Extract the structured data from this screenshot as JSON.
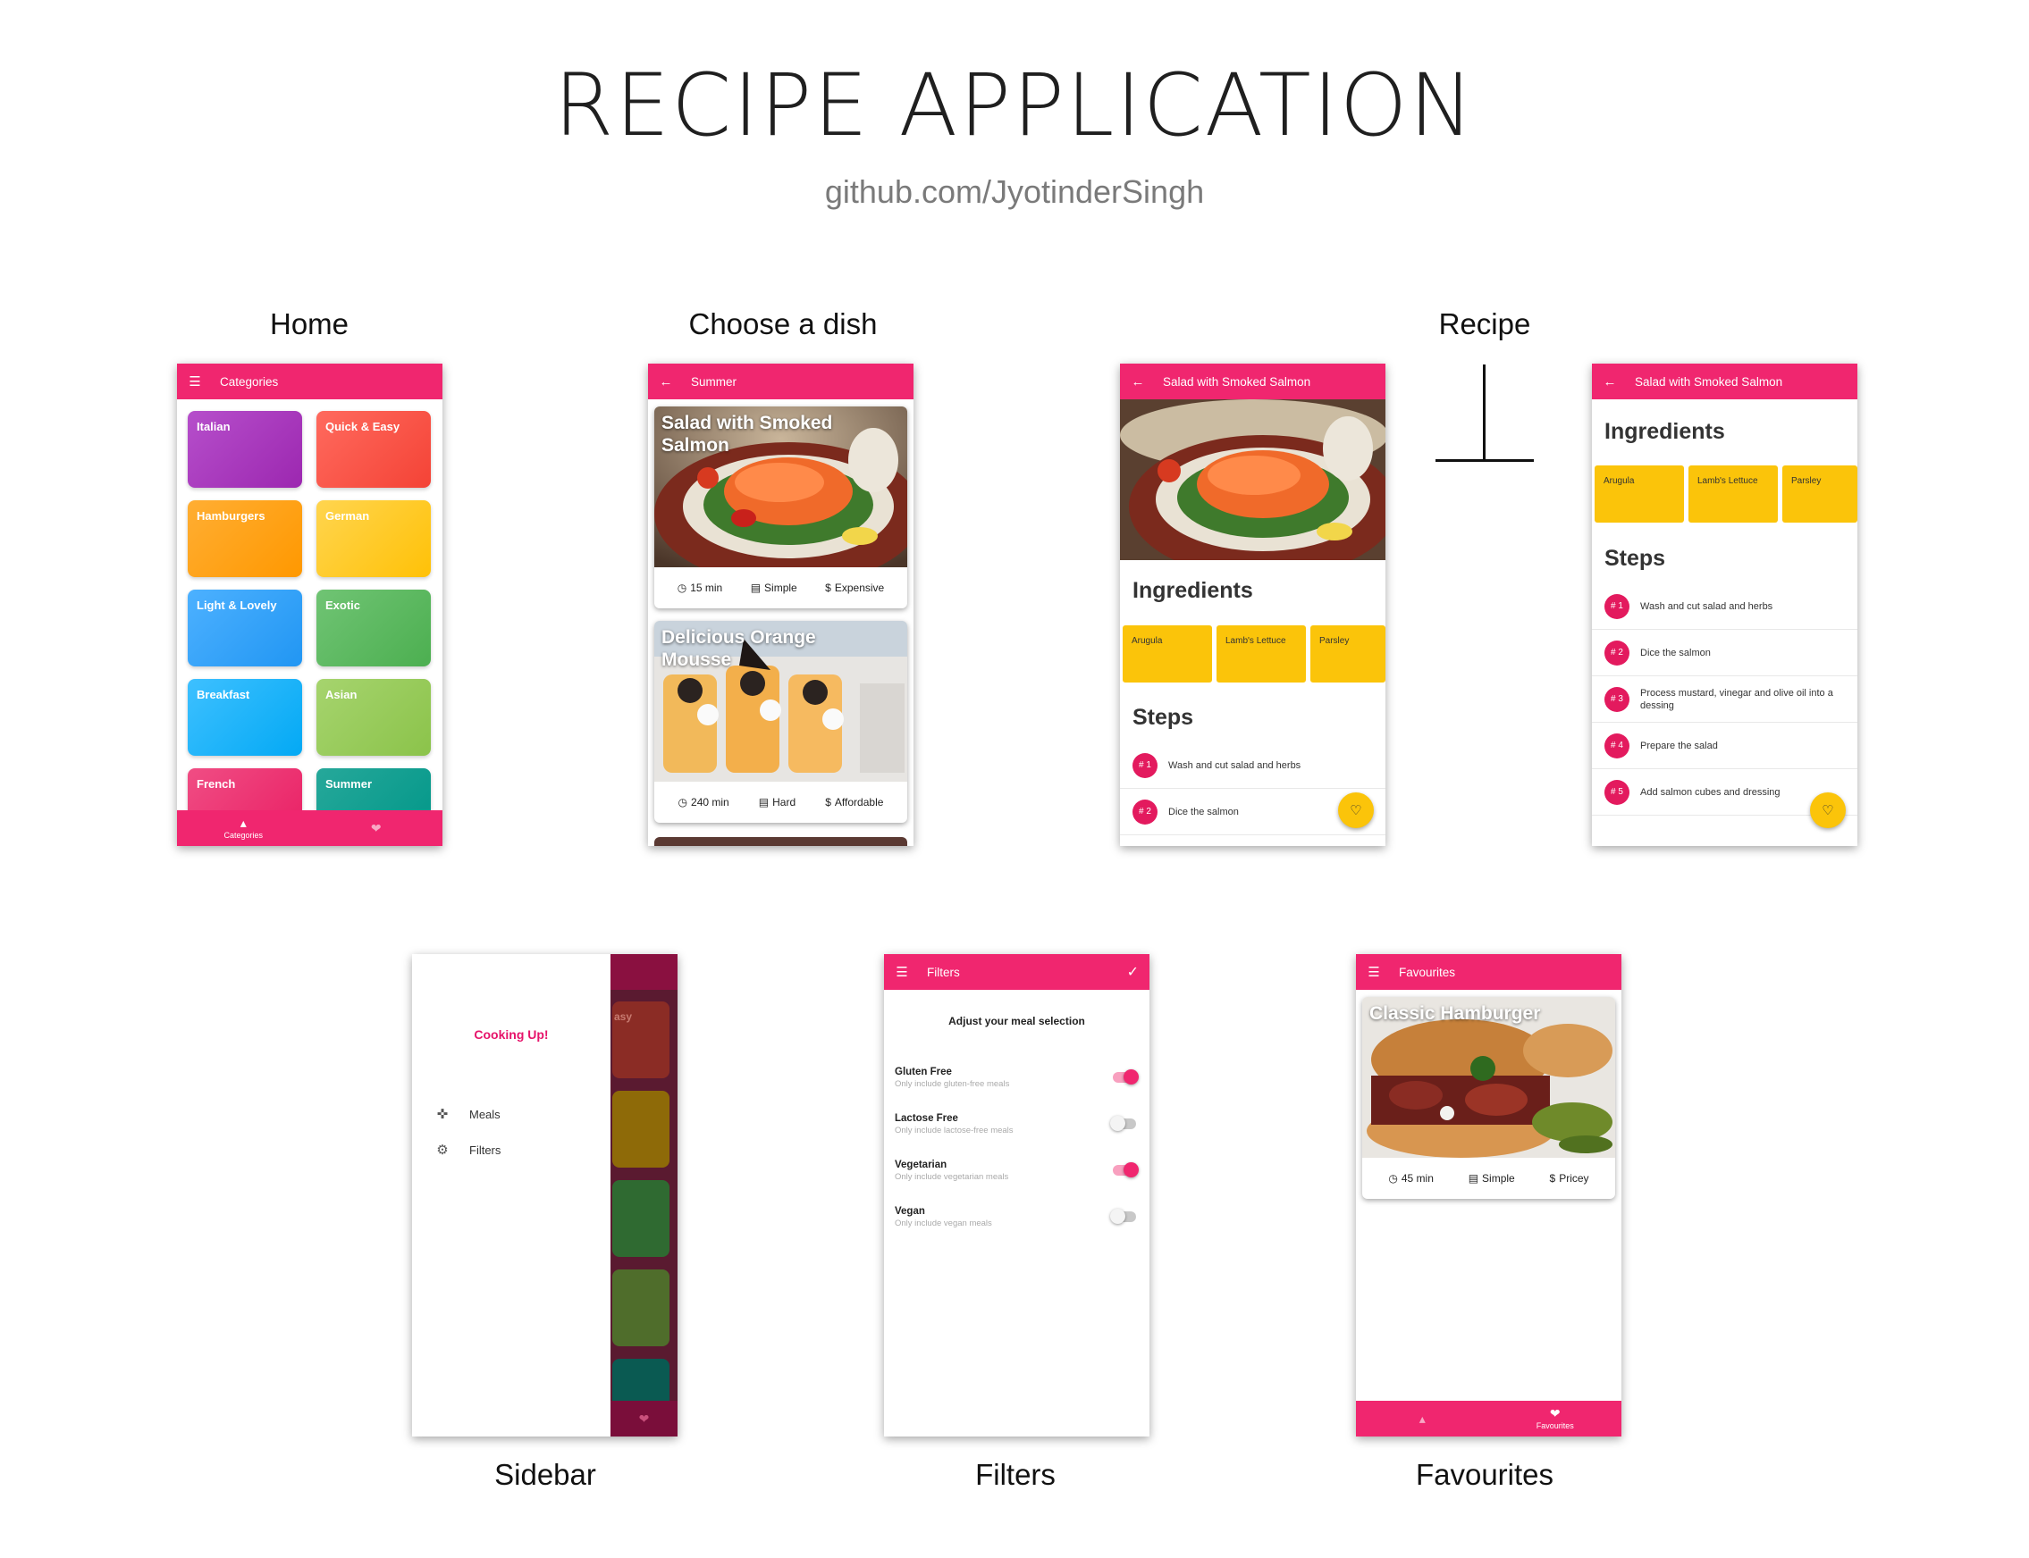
{
  "header": {
    "title": "RECIPE APPLICATION",
    "subtitle": "github.com/JyotinderSingh"
  },
  "labels": {
    "home": "Home",
    "choose": "Choose a dish",
    "recipe": "Recipe",
    "sidebar": "Sidebar",
    "filters": "Filters",
    "favourites": "Favourites"
  },
  "home": {
    "appbar_title": "Categories",
    "categories": [
      {
        "label": "Italian",
        "color": "#9c27b0"
      },
      {
        "label": "Quick & Easy",
        "color": "#f44336"
      },
      {
        "label": "Hamburgers",
        "color": "#ff9800"
      },
      {
        "label": "German",
        "color": "#ffc107"
      },
      {
        "label": "Light & Lovely",
        "color": "#2196f3"
      },
      {
        "label": "Exotic",
        "color": "#4caf50"
      },
      {
        "label": "Breakfast",
        "color": "#03a9f4"
      },
      {
        "label": "Asian",
        "color": "#8bc34a"
      },
      {
        "label": "French",
        "color": "#e91e63"
      },
      {
        "label": "Summer",
        "color": "#009688"
      }
    ],
    "nav": {
      "categories_label": "Categories"
    }
  },
  "choose": {
    "appbar_title": "Summer",
    "dishes": [
      {
        "title": "Salad with Smoked Salmon",
        "duration": "15 min",
        "complexity": "Simple",
        "affordability": "Expensive"
      },
      {
        "title": "Delicious Orange Mousse",
        "duration": "240 min",
        "complexity": "Hard",
        "affordability": "Affordable"
      }
    ]
  },
  "recipe": {
    "appbar_title": "Salad with Smoked Salmon",
    "ingredients_title": "Ingredients",
    "ingredients": [
      "Arugula",
      "Lamb's Lettuce",
      "Parsley"
    ],
    "steps_title": "Steps",
    "steps": [
      {
        "num": "# 1",
        "text": "Wash and cut salad and herbs"
      },
      {
        "num": "# 2",
        "text": "Dice the salmon"
      },
      {
        "num": "# 3",
        "text": "Process mustard, vinegar and olive oil into a dessing"
      },
      {
        "num": "# 4",
        "text": "Prepare the salad"
      },
      {
        "num": "# 5",
        "text": "Add salmon cubes and dressing"
      }
    ]
  },
  "sidebar": {
    "title": "Cooking Up!",
    "items": [
      {
        "label": "Meals",
        "icon": "restaurant-icon"
      },
      {
        "label": "Filters",
        "icon": "settings-icon"
      }
    ],
    "peek_label": "asy"
  },
  "filters": {
    "appbar_title": "Filters",
    "heading": "Adjust your meal selection",
    "options": [
      {
        "title": "Gluten Free",
        "subtitle": "Only include gluten-free meals",
        "on": true
      },
      {
        "title": "Lactose Free",
        "subtitle": "Only include lactose-free meals",
        "on": false
      },
      {
        "title": "Vegetarian",
        "subtitle": "Only include vegetarian meals",
        "on": true
      },
      {
        "title": "Vegan",
        "subtitle": "Only include vegan meals",
        "on": false
      }
    ]
  },
  "favourites": {
    "appbar_title": "Favourites",
    "dish": {
      "title": "Classic Hamburger",
      "duration": "45 min",
      "complexity": "Simple",
      "affordability": "Pricey"
    },
    "nav": {
      "favourites_label": "Favourites"
    }
  },
  "colors": {
    "primary": "#f0266f",
    "accent": "#fbc40a"
  }
}
